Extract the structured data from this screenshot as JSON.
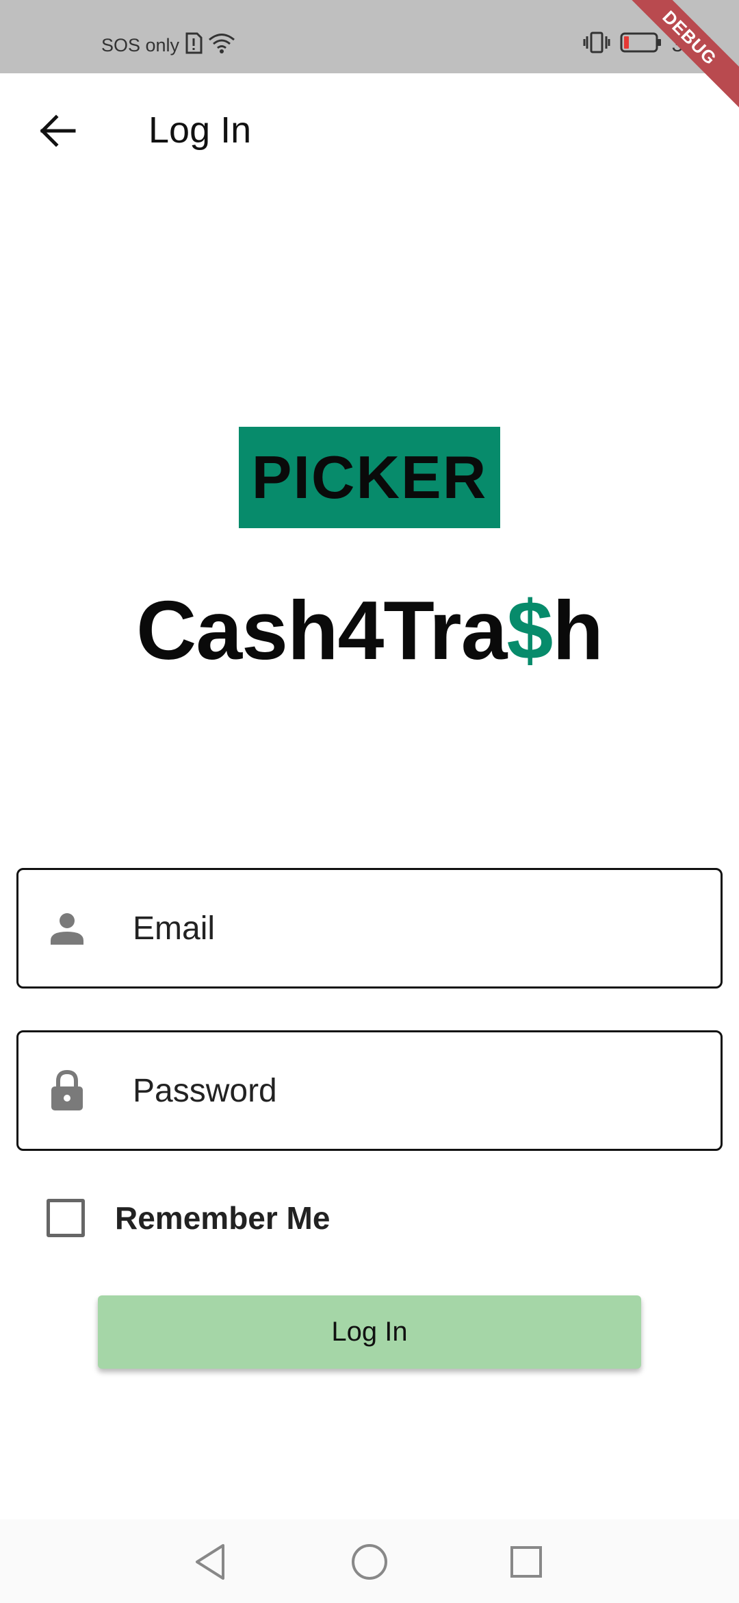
{
  "status_bar": {
    "carrier": "SOS only",
    "time": "3:55",
    "debug_label": "DEBUG",
    "battery_color": "#e53935"
  },
  "app_bar": {
    "title": "Log In",
    "back_icon": "arrow-left-icon"
  },
  "logo": {
    "badge_text": "PICKER",
    "brand_pre": "Cash4Tra",
    "brand_dollar": "$",
    "brand_post": "h",
    "accent_color": "#078b6b"
  },
  "form": {
    "email_placeholder": "Email",
    "email_icon": "person-icon",
    "password_placeholder": "Password",
    "password_icon": "lock-icon",
    "remember_label": "Remember Me",
    "remember_checked": false,
    "login_button_label": "Log In",
    "login_button_color": "#a5d6a7"
  },
  "nav_bar": {
    "back": "triangle-back-icon",
    "home": "circle-home-icon",
    "recents": "square-recents-icon"
  }
}
